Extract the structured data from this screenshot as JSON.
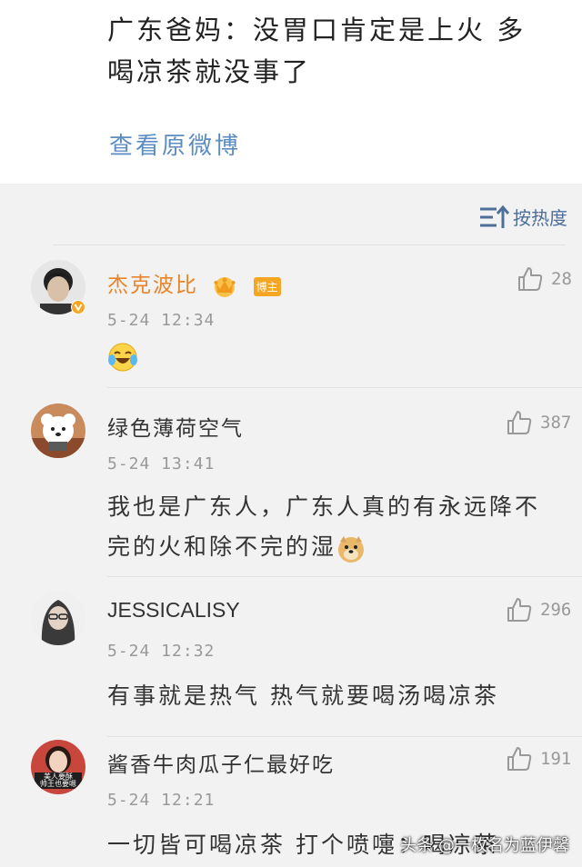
{
  "post": {
    "text_line1": "广东爸妈：没胃口肯定是上火 多",
    "text_line2": "喝凉茶就没事了",
    "view_original": "查看原微博"
  },
  "sort": {
    "label": "按热度",
    "icon": "sort-icon"
  },
  "comments": [
    {
      "username": "杰克波比",
      "host_badge": "博主",
      "time": "5-24 12:34",
      "likes": "28",
      "emoji": "laugh-cry-emoji"
    },
    {
      "username": "绿色薄荷空气",
      "time": "5-24 13:41",
      "likes": "387",
      "text_line1": "我也是广东人，广东人真的有永远降不",
      "text_line2": "完的火和除不完的湿",
      "emoji": "doge-emoji"
    },
    {
      "username": "JESSICALISY",
      "time": "5-24 12:32",
      "likes": "296",
      "text": "有事就是热气 热气就要喝汤喝凉茶"
    },
    {
      "username": "酱香牛肉瓜子仁最好吃",
      "time": "5-24 12:21",
      "likes": "191",
      "text": "一切皆可喝凉茶 打个喷嚏：喝凉茶",
      "avatar_text": "美人要酥\n帅王也要嗯"
    }
  ],
  "watermark": "头条 @一枚名为蓝伊馨",
  "colors": {
    "link": "#5d8cc0",
    "vip_name": "#e8842a",
    "badge": "#f5a623",
    "background": "#f2f2f2"
  }
}
